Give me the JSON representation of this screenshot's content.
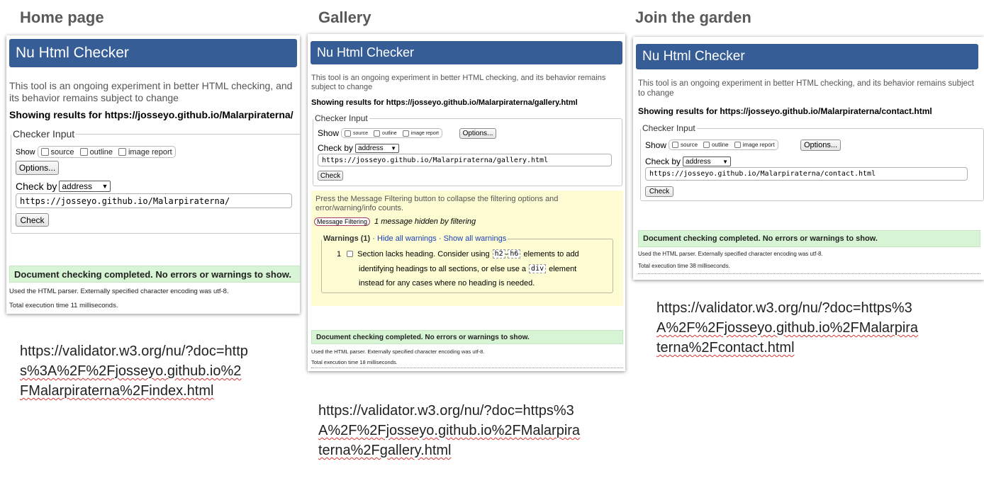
{
  "headings": {
    "home": "Home page",
    "gallery": "Gallery",
    "join": "Join the garden"
  },
  "checker": {
    "title": "Nu Html Checker",
    "intro": "This tool is an ongoing experiment in better HTML checking, and its behavior remains subject to change",
    "fieldset_legend": "Checker Input",
    "show_label": "Show",
    "show_options": [
      "source",
      "outline",
      "image report"
    ],
    "options_button": "Options...",
    "check_by_label": "Check by",
    "check_by_value": "address",
    "check_button": "Check",
    "success_text": "Document checking completed. No errors or warnings to show.",
    "parser_note": "Used the HTML parser. Externally specified character encoding was utf-8."
  },
  "home": {
    "results_for": "Showing results for https://josseyo.github.io/Malarpiraterna/",
    "url_value": "https://josseyo.github.io/Malarpiraterna/",
    "exec_time": "Total execution time 11 milliseconds.",
    "validator_link": {
      "lines": [
        "https://validator.w3.org/nu/?doc=http",
        "s%3A%2F%2Fjosseyo.github.io%2",
        "FMalarpiraterna%2Findex.html"
      ]
    }
  },
  "gallery": {
    "results_for": "Showing results for https://josseyo.github.io/Malarpiraterna/gallery.html",
    "url_value": "https://josseyo.github.io/Malarpiraterna/gallery.html",
    "filter_note": "Press the Message Filtering button to collapse the filtering options and error/warning/info counts.",
    "filter_button": "Message Filtering",
    "hidden_note": "1 message hidden by filtering",
    "warnings_legend": "Warnings (1)",
    "hide_all": "Hide all warnings",
    "show_all": "Show all warnings",
    "sep": "·",
    "warning": {
      "number": "1",
      "text_part1": "Section lacks heading. Consider using",
      "code1": "h2",
      "dash": "-",
      "code2": "h6",
      "text_part2": "elements to add",
      "text_part3": "identifying headings to all sections, or else use a",
      "code3": "div",
      "text_part4": "element",
      "text_part5": "instead for any cases where no heading is needed."
    },
    "exec_time": "Total execution time 18 milliseconds.",
    "validator_link": {
      "lines": [
        "https://validator.w3.org/nu/?doc=https%3",
        "A%2F%2Fjosseyo.github.io%2FMalarpira",
        "terna%2Fgallery.html"
      ]
    }
  },
  "contact": {
    "results_for": "Showing results for https://josseyo.github.io/Malarpiraterna/contact.html",
    "url_value": "https://josseyo.github.io/Malarpiraterna/contact.html",
    "exec_time": "Total execution time 38 milliseconds.",
    "validator_link": {
      "lines": [
        "https://validator.w3.org/nu/?doc=https%3",
        "A%2F%2Fjosseyo.github.io%2FMalarpira",
        "terna%2Fcontact.html"
      ]
    }
  }
}
